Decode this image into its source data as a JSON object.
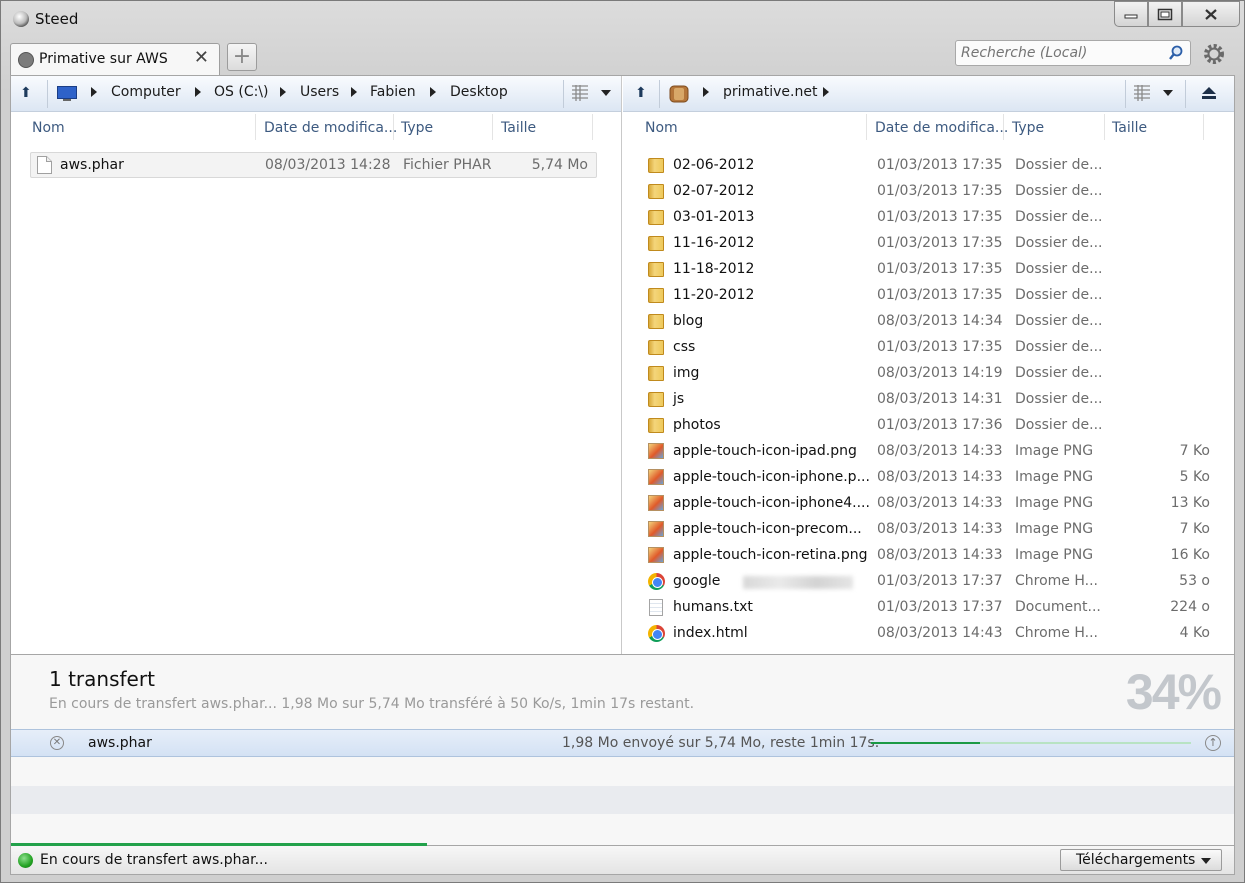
{
  "window": {
    "title": "Steed"
  },
  "tab": {
    "label": "Primative sur AWS",
    "close": "✕",
    "add": "+"
  },
  "search": {
    "placeholder": "Recherche (Local)"
  },
  "left": {
    "breadcrumb": [
      "Computer",
      "OS (C:\\)",
      "Users",
      "Fabien",
      "Desktop"
    ],
    "columns": {
      "name": "Nom",
      "date": "Date de modifica...",
      "type": "Type",
      "size": "Taille"
    },
    "files": [
      {
        "icon": "file-icon",
        "name": "aws.phar",
        "date": "08/03/2013 14:28",
        "type": "Fichier PHAR",
        "size": "5,74 Mo"
      }
    ]
  },
  "right": {
    "breadcrumb": [
      "primative.net"
    ],
    "columns": {
      "name": "Nom",
      "date": "Date de modifica...",
      "type": "Type",
      "size": "Taille"
    },
    "files": [
      {
        "icon": "folder",
        "name": "02-06-2012",
        "date": "01/03/2013 17:35",
        "type": "Dossier de...",
        "size": ""
      },
      {
        "icon": "folder",
        "name": "02-07-2012",
        "date": "01/03/2013 17:35",
        "type": "Dossier de...",
        "size": ""
      },
      {
        "icon": "folder",
        "name": "03-01-2013",
        "date": "01/03/2013 17:35",
        "type": "Dossier de...",
        "size": ""
      },
      {
        "icon": "folder",
        "name": "11-16-2012",
        "date": "01/03/2013 17:35",
        "type": "Dossier de...",
        "size": ""
      },
      {
        "icon": "folder",
        "name": "11-18-2012",
        "date": "01/03/2013 17:35",
        "type": "Dossier de...",
        "size": ""
      },
      {
        "icon": "folder",
        "name": "11-20-2012",
        "date": "01/03/2013 17:35",
        "type": "Dossier de...",
        "size": ""
      },
      {
        "icon": "folder",
        "name": "blog",
        "date": "08/03/2013 14:34",
        "type": "Dossier de...",
        "size": ""
      },
      {
        "icon": "folder",
        "name": "css",
        "date": "01/03/2013 17:35",
        "type": "Dossier de...",
        "size": ""
      },
      {
        "icon": "folder",
        "name": "img",
        "date": "08/03/2013 14:19",
        "type": "Dossier de...",
        "size": ""
      },
      {
        "icon": "folder",
        "name": "js",
        "date": "08/03/2013 14:31",
        "type": "Dossier de...",
        "size": ""
      },
      {
        "icon": "folder",
        "name": "photos",
        "date": "01/03/2013 17:36",
        "type": "Dossier de...",
        "size": ""
      },
      {
        "icon": "png",
        "name": "apple-touch-icon-ipad.png",
        "date": "08/03/2013 14:33",
        "type": "Image PNG",
        "size": "7 Ko"
      },
      {
        "icon": "png",
        "name": "apple-touch-icon-iphone.p...",
        "date": "08/03/2013 14:33",
        "type": "Image PNG",
        "size": "5 Ko"
      },
      {
        "icon": "png",
        "name": "apple-touch-icon-iphone4....",
        "date": "08/03/2013 14:33",
        "type": "Image PNG",
        "size": "13 Ko"
      },
      {
        "icon": "png",
        "name": "apple-touch-icon-precom...",
        "date": "08/03/2013 14:33",
        "type": "Image PNG",
        "size": "7 Ko"
      },
      {
        "icon": "png",
        "name": "apple-touch-icon-retina.png",
        "date": "08/03/2013 14:33",
        "type": "Image PNG",
        "size": "16 Ko"
      },
      {
        "icon": "chrome",
        "name": "google",
        "blurred": true,
        "date": "01/03/2013 17:37",
        "type": "Chrome H...",
        "size": "53 o"
      },
      {
        "icon": "doc",
        "name": "humans.txt",
        "date": "01/03/2013 17:37",
        "type": "Document...",
        "size": "224 o"
      },
      {
        "icon": "chrome",
        "name": "index.html",
        "date": "08/03/2013 14:43",
        "type": "Chrome H...",
        "size": "4 Ko"
      }
    ]
  },
  "transfers": {
    "title": "1 transfert",
    "subtitle": "En cours de transfert aws.phar... 1,98 Mo sur 5,74 Mo transféré à 50 Ko/s, 1min 17s restant.",
    "percent_label": "34%",
    "items": [
      {
        "name": "aws.phar",
        "info": "1,98 Mo envoyé sur 5,74 Mo, reste 1min 17s.",
        "progress": 0.34
      }
    ]
  },
  "status": {
    "text": "En cours de transfert aws.phar...",
    "progress": 0.34,
    "downloads_button": "Téléchargements"
  },
  "colors": {
    "accent": "#1b9a45",
    "header_text": "#3d5a80"
  }
}
